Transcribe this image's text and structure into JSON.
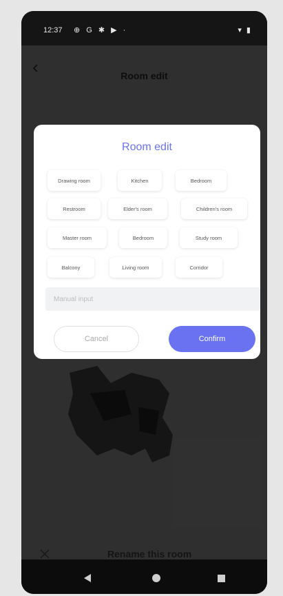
{
  "statusbar": {
    "time": "12:37",
    "icons": "⊕ G ✱ ▶ ·",
    "right_icons": "▾ ▮"
  },
  "appbar": {
    "title": "Room edit",
    "back_icon": "chevron-left-icon"
  },
  "dialog": {
    "title": "Room edit",
    "chips_row1": [
      "Drawing room",
      "Kitchen",
      "Bedroom"
    ],
    "chips_row2": [
      "Restroom",
      "Elder's room",
      "Children's room"
    ],
    "chips_row3": [
      "Master room",
      "Bedroom",
      "Study room"
    ],
    "chips_row4": [
      "Balcony",
      "Living room",
      "Corridor"
    ],
    "input_placeholder": "Manual input",
    "cancel_label": "Cancel",
    "confirm_label": "Confirm"
  },
  "bottombar": {
    "close_icon": "close-icon",
    "rename_label": "Rename this room"
  },
  "colors": {
    "accent": "#6a72f1",
    "dialog_bg": "#ffffff",
    "screen_bg": "#3a3a3a"
  }
}
